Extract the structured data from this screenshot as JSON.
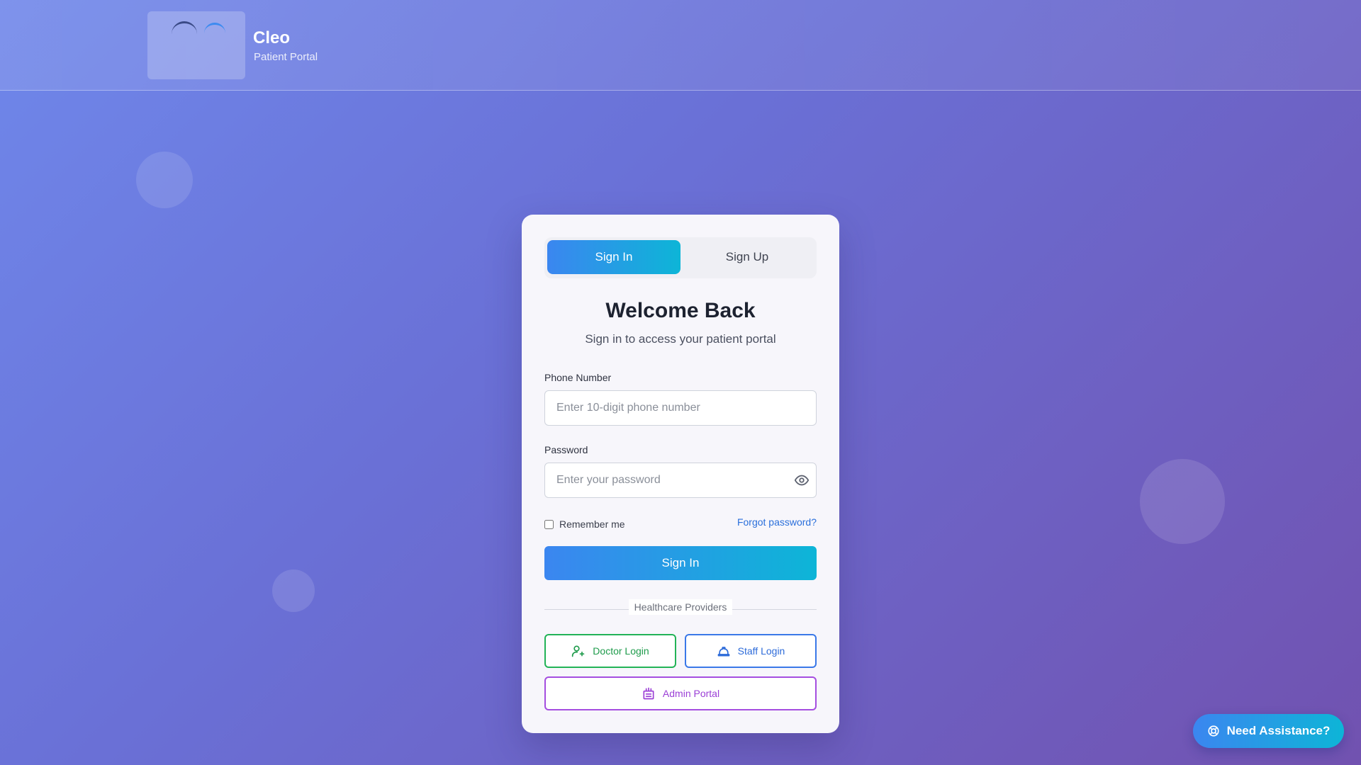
{
  "header": {
    "brand_name": "Cleo",
    "brand_subtitle": "Patient Portal"
  },
  "tabs": {
    "sign_in": "Sign In",
    "sign_up": "Sign Up",
    "active": "Sign In"
  },
  "form": {
    "title": "Welcome Back",
    "subtitle": "Sign in to access your patient portal",
    "phone_label": "Phone Number",
    "phone_placeholder": "Enter 10-digit phone number",
    "phone_value": "",
    "password_label": "Password",
    "password_placeholder": "Enter your password",
    "password_value": "",
    "remember_label": "Remember me",
    "remember_checked": false,
    "forgot_label": "Forgot password?",
    "submit_label": "Sign In"
  },
  "providers": {
    "divider_label": "Healthcare Providers",
    "doctor_label": "Doctor Login",
    "staff_label": "Staff Login",
    "admin_label": "Admin Portal",
    "doctor_icon": "user-plus-icon",
    "staff_icon": "hard-hat-icon",
    "admin_icon": "building-icon"
  },
  "assistance": {
    "label": "Need Assistance?",
    "icon": "lifebuoy-icon"
  },
  "colors": {
    "accent_gradient_start": "#3b86f0",
    "accent_gradient_end": "#0db5d7",
    "doctor": "#22b357",
    "staff": "#3a78e8",
    "admin": "#a54ee0"
  }
}
